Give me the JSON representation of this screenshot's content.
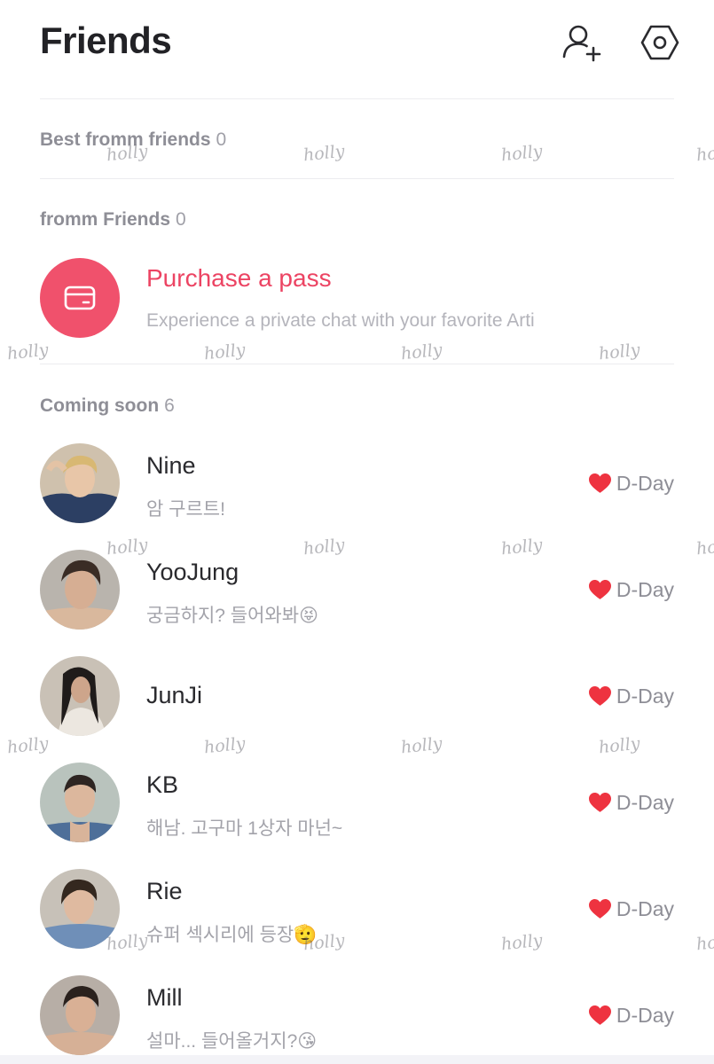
{
  "header": {
    "title": "Friends",
    "add_friend_icon": "add-person-icon",
    "settings_icon": "settings-icon"
  },
  "sections": {
    "best": {
      "label": "Best fromm friends",
      "count": "0"
    },
    "fromm": {
      "label": "fromm Friends",
      "count": "0"
    },
    "coming": {
      "label": "Coming soon",
      "count": "6"
    }
  },
  "pass": {
    "title": "Purchase a pass",
    "subtitle": "Experience a private chat with your favorite Arti",
    "icon": "card-icon"
  },
  "friends": [
    {
      "name": "Nine",
      "status": "암 구르트!",
      "badge": "D-Day"
    },
    {
      "name": "YooJung",
      "status": "궁금하지? 들어와봐😝",
      "badge": "D-Day"
    },
    {
      "name": "JunJi",
      "status": "",
      "badge": "D-Day"
    },
    {
      "name": "KB",
      "status": "해남. 고구마 1상자 마넌~",
      "badge": "D-Day"
    },
    {
      "name": "Rie",
      "status": "슈퍼 섹시리에 등장🫡",
      "badge": "D-Day"
    },
    {
      "name": "Mill",
      "status": "설마... 들어올거지?😘",
      "badge": "D-Day"
    }
  ],
  "watermark": "holly",
  "colors": {
    "accent": "#f0516c",
    "heart": "#ee3340",
    "label": "#8e8e96"
  }
}
